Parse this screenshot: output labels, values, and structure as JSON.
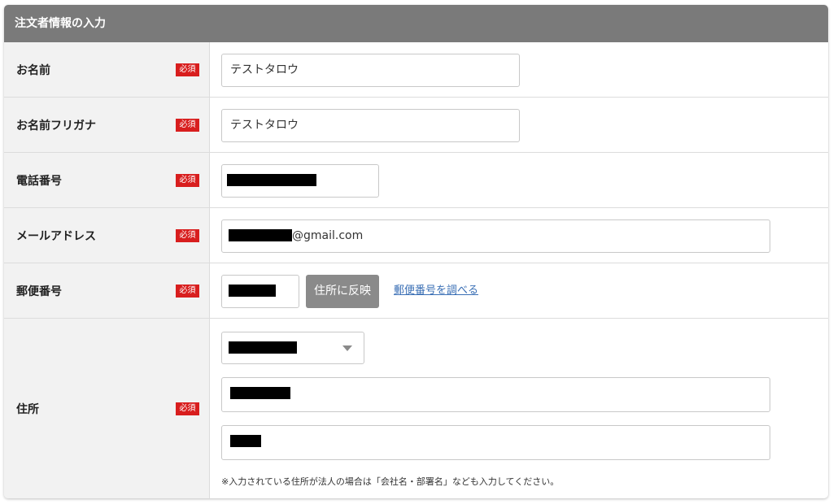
{
  "section_title": "注文者情報の入力",
  "required_label": "必須",
  "fields": {
    "name": {
      "label": "お名前",
      "value": "テストタロウ"
    },
    "name_kana": {
      "label": "お名前フリガナ",
      "value": "テストタロウ"
    },
    "phone": {
      "label": "電話番号"
    },
    "email": {
      "label": "メールアドレス",
      "domain_suffix": "@gmail.com"
    },
    "postal_code": {
      "label": "郵便番号",
      "reflect_button": "住所に反映",
      "lookup_link": "郵便番号を調べる"
    },
    "address": {
      "label": "住所",
      "note": "※入力されている住所が法人の場合は「会社名・部署名」なども入力してください。"
    }
  }
}
